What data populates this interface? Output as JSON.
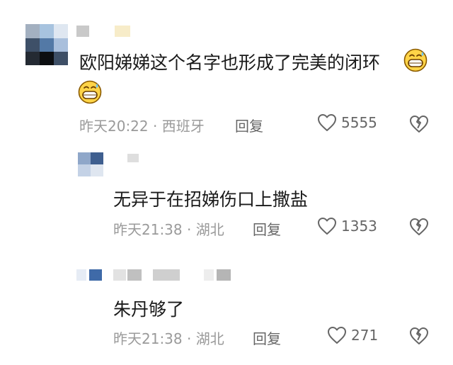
{
  "comments": [
    {
      "text": "欧阳娣娣这个名字也形成了完美的闭环",
      "time": "昨天20:22",
      "location": "西班牙",
      "reply_label": "回复",
      "like_count": "5555",
      "emoji": "grinning-sweat-emoji"
    },
    {
      "text": "无异于在招娣伤口上撒盐",
      "time": "昨天21:38",
      "location": "湖北",
      "reply_label": "回复",
      "like_count": "1353"
    },
    {
      "text": "朱丹够了",
      "time": "昨天21:38",
      "location": "湖北",
      "reply_label": "回复",
      "like_count": "271"
    }
  ],
  "separator": " · ",
  "colors": {
    "text": "#1a1a1a",
    "meta": "#9a9a9a",
    "action": "#666666"
  }
}
